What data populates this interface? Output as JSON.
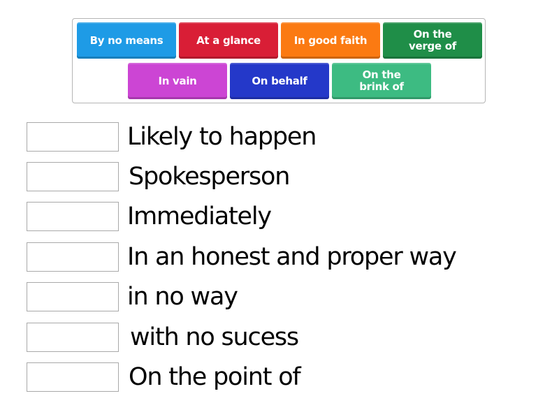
{
  "word_bank": {
    "tiles": [
      {
        "label": "By no means",
        "color": "#1e9be6"
      },
      {
        "label": "At a glance",
        "color": "#d91e36"
      },
      {
        "label": "In good faith",
        "color": "#fb7a12"
      },
      {
        "label": "On the verge of",
        "color": "#1f8e48"
      },
      {
        "label": "In vain",
        "color": "#cc45d4"
      },
      {
        "label": "On behalf",
        "color": "#2438c9"
      },
      {
        "label": "On the brink of",
        "color": "#3dbb82"
      }
    ]
  },
  "clues": [
    {
      "text": "Likely to happen",
      "answer": ""
    },
    {
      "text": "Spokesperson",
      "answer": ""
    },
    {
      "text": "Immediately",
      "answer": ""
    },
    {
      "text": "In an honest and proper way",
      "answer": ""
    },
    {
      "text": "in no way",
      "answer": ""
    },
    {
      "text": "with no sucess",
      "answer": ""
    },
    {
      "text": "On the point of",
      "answer": ""
    }
  ]
}
